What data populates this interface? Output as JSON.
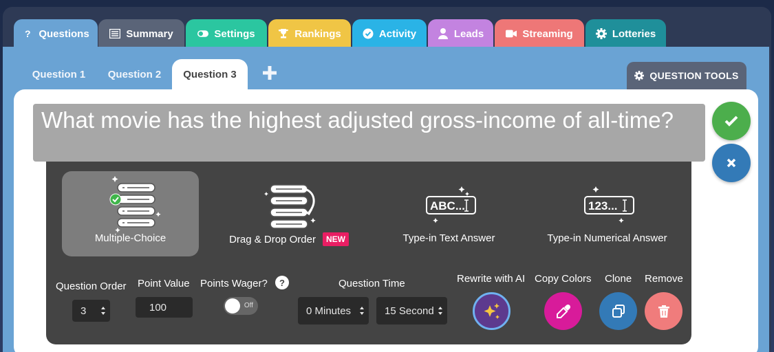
{
  "top_tabs": [
    {
      "label": "Questions",
      "icon": "question-icon",
      "color": "#6aa3d4"
    },
    {
      "label": "Summary",
      "icon": "list-icon",
      "color": "#5a6478"
    },
    {
      "label": "Settings",
      "icon": "toggle-icon",
      "color": "#2bc6a0"
    },
    {
      "label": "Rankings",
      "icon": "trophy-icon",
      "color": "#f0c545"
    },
    {
      "label": "Activity",
      "icon": "check-circle-icon",
      "color": "#2ab3e6"
    },
    {
      "label": "Leads",
      "icon": "user-icon",
      "color": "#c383e0"
    },
    {
      "label": "Streaming",
      "icon": "video-icon",
      "color": "#ee7777"
    },
    {
      "label": "Lotteries",
      "icon": "gear-icon",
      "color": "#1f8f9a"
    }
  ],
  "question_tabs": [
    "Question 1",
    "Question 2",
    "Question 3"
  ],
  "question_tools_label": "QUESTION TOOLS",
  "question_text": "What movie has the highest adjusted gross-income of all-time?",
  "question_types": [
    {
      "label": "Multiple-Choice",
      "selected": true
    },
    {
      "label": "Drag & Drop Order",
      "badge": "NEW"
    },
    {
      "label": "Type-in Text Answer",
      "icon_text": "ABC..."
    },
    {
      "label": "Type-in Numerical Answer",
      "icon_text": "123..."
    }
  ],
  "controls": {
    "question_order_label": "Question Order",
    "question_order_value": "3",
    "point_value_label": "Point Value",
    "point_value": "100",
    "points_wager_label": "Points Wager?",
    "points_wager_state": "Off",
    "question_time_label": "Question Time",
    "minutes_value": "0 Minutes",
    "seconds_value": "15 Second",
    "rewrite_label": "Rewrite with AI",
    "copy_colors_label": "Copy Colors",
    "clone_label": "Clone",
    "remove_label": "Remove"
  },
  "colors": {
    "save": "#4cae4c",
    "cancel": "#337ab7",
    "copy_colors": "#d81b9a",
    "clone": "#337ab7",
    "remove": "#f07c7c"
  }
}
